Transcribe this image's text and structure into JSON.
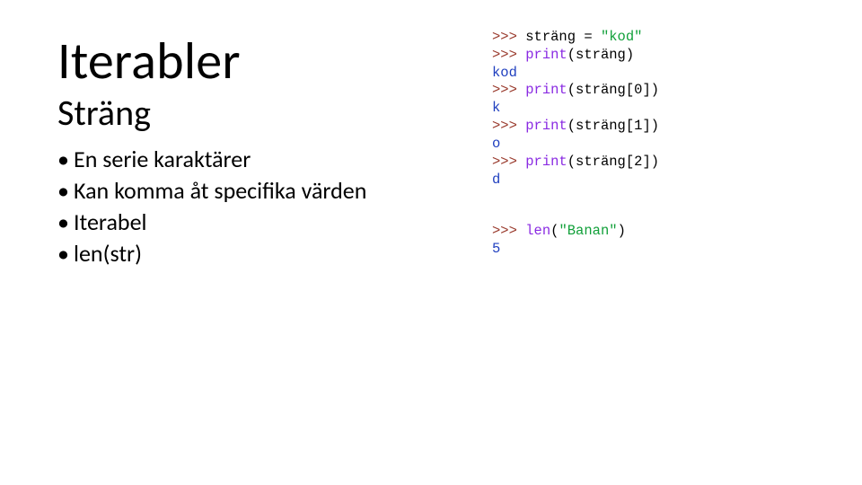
{
  "text": {
    "title": "Iterabler",
    "subtitle": "Sträng",
    "bullets": [
      "En serie karaktärer",
      "Kan komma åt specifika värden",
      "Iterabel",
      "len(str)"
    ]
  },
  "code1": {
    "l1_prompt": ">>> ",
    "l1_var": "sträng ",
    "l1_eq": "= ",
    "l1_str": "\"kod\"",
    "l2_prompt": ">>> ",
    "l2_func": "print",
    "l2_rest": "(sträng)",
    "l3_out": "kod",
    "l4_prompt": ">>> ",
    "l4_func": "print",
    "l4_rest": "(sträng[0])",
    "l5_out": "k",
    "l6_prompt": ">>> ",
    "l6_func": "print",
    "l6_rest": "(sträng[1])",
    "l7_out": "o",
    "l8_prompt": ">>> ",
    "l8_func": "print",
    "l8_rest": "(sträng[2])",
    "l9_out": "d"
  },
  "code2": {
    "l1_prompt": ">>> ",
    "l1_func": "len",
    "l1_open": "(",
    "l1_str": "\"Banan\"",
    "l1_close": ")",
    "l2_out": "5"
  }
}
